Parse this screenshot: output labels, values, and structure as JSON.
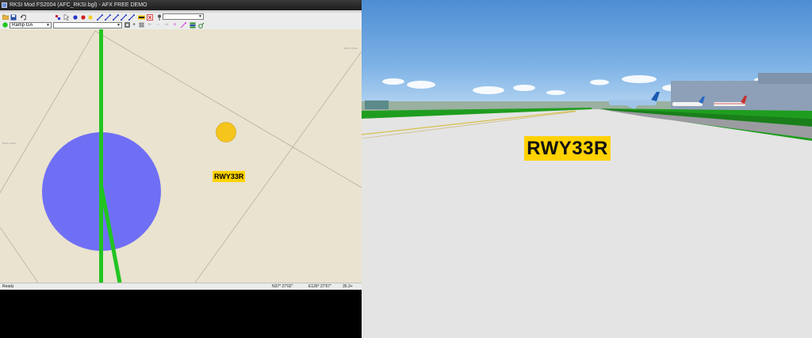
{
  "window": {
    "title": "RKSI Mod FS2004 (AFC_RKSI.bgl) - AFX FREE DEMO"
  },
  "toolbar": {
    "object_select_value": "",
    "type_select_value": "Ramp GA",
    "filter_select_value": ""
  },
  "map": {
    "sign_label": "RWY33R",
    "tiny_labels": [
      "BGKP 2FSE",
      "BGKP 2FSE"
    ],
    "colors": {
      "background": "#eae3cf",
      "taxiway_path": "#22c422",
      "parking_circle": "#6f6ff5",
      "vor_circle": "#f5c51c"
    }
  },
  "status": {
    "ready_text": "Ready",
    "latitude": "N37* 27'02\"",
    "longitude": "E126* 27'57\"",
    "zoom": "35.3+"
  },
  "sim_view": {
    "sign_text": "RWY33R",
    "colors": {
      "sign_background": "#ffd200",
      "sky_top": "#4d8dd3",
      "grass": "#1f9d1f",
      "runway": "#e4e4e4"
    }
  }
}
